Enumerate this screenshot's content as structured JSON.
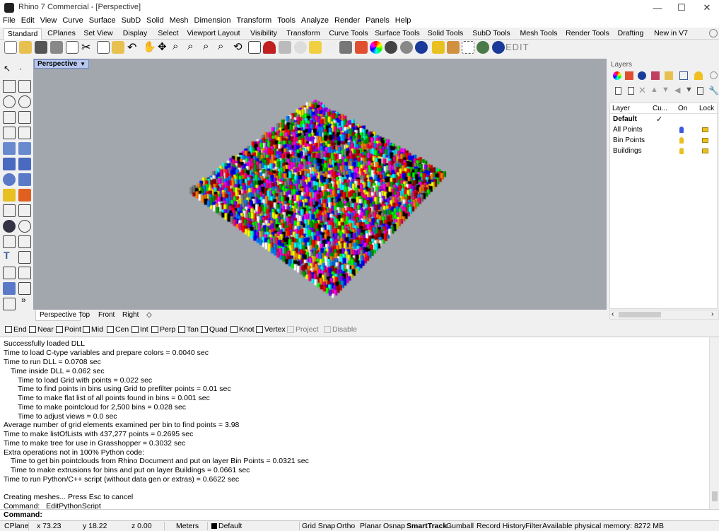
{
  "window": {
    "title": "Rhino 7 Commercial - [Perspective]",
    "min": "—",
    "max": "☐",
    "close": "✕"
  },
  "menu": [
    "File",
    "Edit",
    "View",
    "Curve",
    "Surface",
    "SubD",
    "Solid",
    "Mesh",
    "Dimension",
    "Transform",
    "Tools",
    "Analyze",
    "Render",
    "Panels",
    "Help"
  ],
  "tabs": [
    "Standard",
    "CPlanes",
    "Set View",
    "Display",
    "Select",
    "Viewport Layout",
    "Visibility",
    "Transform",
    "Curve Tools",
    "Surface Tools",
    "Solid Tools",
    "SubD Tools",
    "Mesh Tools",
    "Render Tools",
    "Drafting",
    "New in V7"
  ],
  "toolbar_edit_label": "EDIT",
  "viewport": {
    "label": "Perspective",
    "tabs": [
      "Perspective",
      "Top",
      "Front",
      "Right"
    ],
    "add_tab": "◇"
  },
  "layers": {
    "title": "Layers",
    "columns": {
      "layer": "Layer",
      "current": "Cu...",
      "on": "On",
      "lock": "Lock"
    },
    "rows": [
      {
        "name": "Default",
        "current": "✓",
        "color": "#000000"
      },
      {
        "name": "All Points",
        "current": "",
        "color": "#3a5be0"
      },
      {
        "name": "Bin Points",
        "current": "",
        "color": "#e8c020"
      },
      {
        "name": "Buildings",
        "current": "",
        "color": "#e8c020"
      }
    ]
  },
  "osnap": [
    "End",
    "Near",
    "Point",
    "Mid",
    "Cen",
    "Int",
    "Perp",
    "Tan",
    "Quad",
    "Knot",
    "Vertex",
    "Project",
    "Disable"
  ],
  "history": [
    "Successfully loaded DLL",
    "Time to load C-type variables and prepare colors = 0.0040 sec",
    "Time to run DLL = 0.0708 sec",
    "Time inside DLL = 0.062 sec",
    "Time to load Grid with points = 0.022 sec",
    "Time to find points in bins using Grid to prefilter points = 0.01 sec",
    "Time to make flat list of all points found in bins = 0.001 sec",
    "Time to make pointcloud for 2,500 bins = 0.028 sec",
    "Time to adjust views = 0.0 sec",
    "Average number of grid elements examined per bin to find points = 3.98",
    "Time to make listOfLists with 437,277 points = 0.2695 sec",
    "Time to make tree for use in Grasshopper = 0.3032 sec",
    "Extra operations not in 100% Python code:",
    "Time to get bin pointclouds from Rhino Document and put on layer Bin Points = 0.0321 sec",
    "Time to make extrusions for bins and put on layer Buildings = 0.0661 sec",
    "Time to run Python/C++ script (without data gen or extras) = 0.6622 sec",
    "",
    "Creating meshes... Press Esc to cancel",
    "Command: _EditPythonScript"
  ],
  "command_prompt": "Command:",
  "status": {
    "cplane": "CPlane",
    "x": "x 73.23",
    "y": "y 18.22",
    "z": "z 0.00",
    "units": "Meters",
    "layer": "Default",
    "grid_snap": "Grid Snap",
    "ortho": "Ortho",
    "planar": "Planar",
    "osnap": "Osnap",
    "smarttrack": "SmartTrack",
    "gumball": "Gumball",
    "record_history": "Record History",
    "filter": "Filter",
    "memory": "Available physical memory: 8272 MB"
  },
  "colors": {
    "viewport_bg": "#a2a6ad",
    "active_label": "#b7c7ee"
  }
}
